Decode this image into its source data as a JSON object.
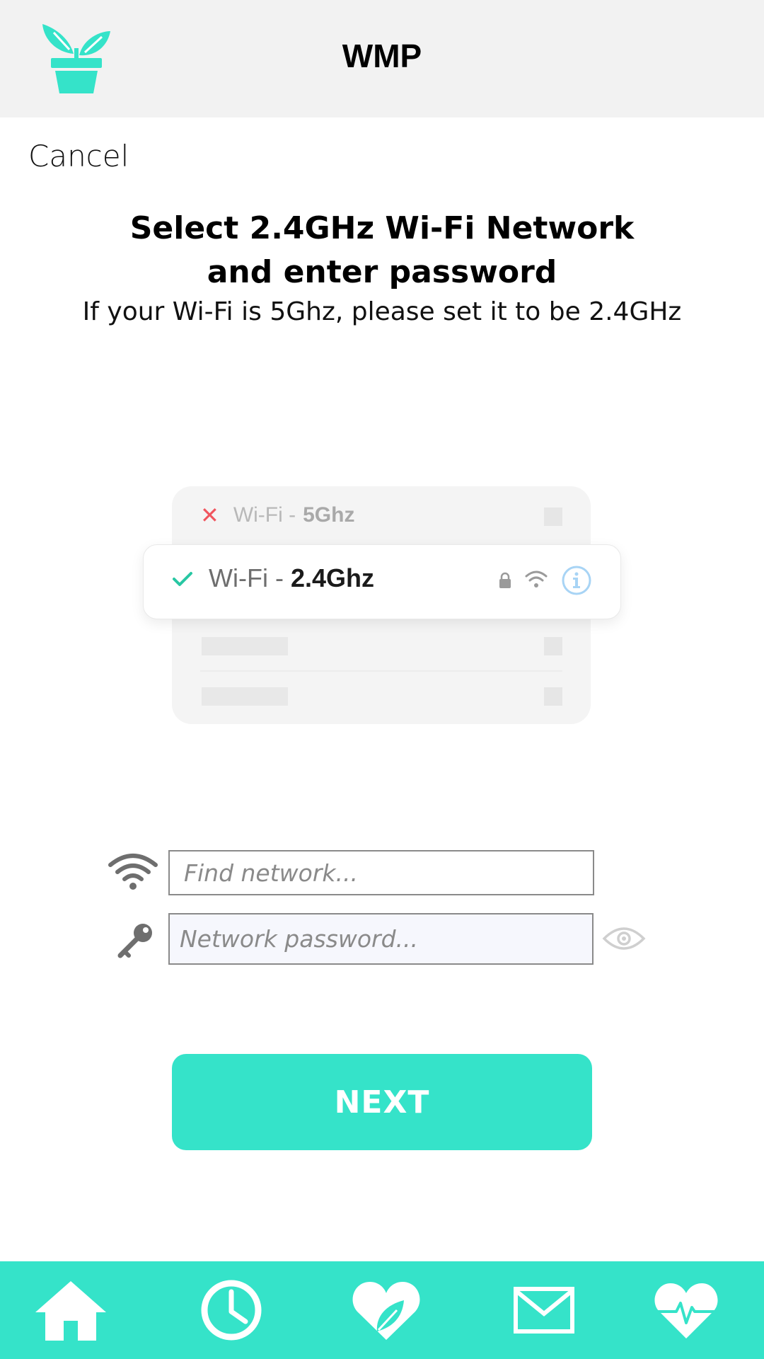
{
  "header": {
    "title": "WMP",
    "logo_icon": "plant-pot-icon"
  },
  "cancel_label": "Cancel",
  "title": "Select 2.4GHz Wi-Fi Network and enter password",
  "subtitle": "If your Wi-Fi is 5Ghz, please set it to be 2.4GHz",
  "illustration": {
    "row_5ghz": {
      "prefix": "Wi-Fi -",
      "band": "5Ghz",
      "status_icon": "x-icon"
    },
    "row_24ghz": {
      "prefix": "Wi-Fi -",
      "band": "2.4Ghz",
      "status_icon": "check-icon"
    }
  },
  "form": {
    "network_placeholder": "Find network...",
    "network_value": "",
    "password_placeholder": "Network password...",
    "password_value": ""
  },
  "next_label": "NEXT",
  "bottom_nav": [
    {
      "icon": "home-icon"
    },
    {
      "icon": "clock-icon"
    },
    {
      "icon": "heart-leaf-icon"
    },
    {
      "icon": "mail-icon"
    },
    {
      "icon": "heart-pulse-icon"
    }
  ],
  "colors": {
    "accent": "#35e3c9",
    "header_bg": "#f2f2f2",
    "error": "#f0555e",
    "info": "#a8d4f5"
  }
}
